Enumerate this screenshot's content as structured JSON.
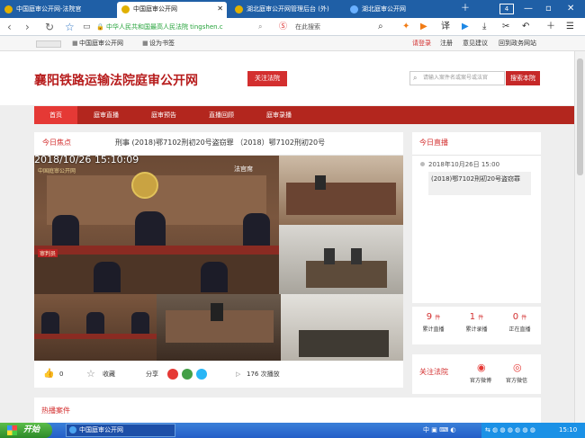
{
  "browser": {
    "tabs": [
      {
        "label": "中国庭审公开网-法院官",
        "active": false
      },
      {
        "label": "中国庭审公开网",
        "active": true
      },
      {
        "label": "湖北庭审公开网管理后台 (外)",
        "active": false
      },
      {
        "label": "湖北庭审公开网",
        "active": false
      }
    ],
    "tab_count": "4",
    "address": "中华人民共和国最高人民法院  tingshen.c",
    "search_placeholder": "在此搜索",
    "translate_label": "译"
  },
  "favbar": {
    "items": [
      "中国庭审公开网",
      "设为书签"
    ],
    "right": [
      "请登录",
      "注册",
      "意见建议",
      "回到政务网站"
    ]
  },
  "site": {
    "title": "襄阳铁路运输法院庭审公开网",
    "follow_label": "关注法院",
    "search_placeholder": "请输入案件名或案号或法官",
    "search_button": "搜索本院"
  },
  "menu": [
    "首页",
    "庭审直播",
    "庭审预告",
    "直播回顾",
    "庭审录播"
  ],
  "focus": {
    "title": "今日焦点",
    "case": "刑事 (2018)鄂7102刑初20号盗窃罪 （2018）鄂7102刑初20号",
    "timestamp": "2018/10/26  15:10:09",
    "court_label": "中国庭审公开网",
    "seat_label": "法官席",
    "judge_plate": "审判员"
  },
  "actions": {
    "likes": "0",
    "favorite": "收藏",
    "share": "分享",
    "plays": "176 次播放"
  },
  "today_live": {
    "title": "今日直播",
    "time": "2018年10月26日 15:00",
    "case": "(2018)鄂7102刑初20号盗窃罪"
  },
  "stats": [
    {
      "value": "9",
      "unit": "件",
      "label": "累计直播"
    },
    {
      "value": "1",
      "unit": "件",
      "label": "累计录播"
    },
    {
      "value": "0",
      "unit": "件",
      "label": "正在直播"
    }
  ],
  "follow_court": {
    "title": "关注法院",
    "weibo": "官方微博",
    "wechat": "官方微信"
  },
  "hot": {
    "title": "热播案件"
  },
  "taskbar": {
    "start": "开始",
    "task": "中国庭审公开网",
    "time": "15:10"
  },
  "colors": {
    "brand_red": "#b3261e",
    "accent": "#d32f2f",
    "browser_blue": "#1f5fa6"
  }
}
